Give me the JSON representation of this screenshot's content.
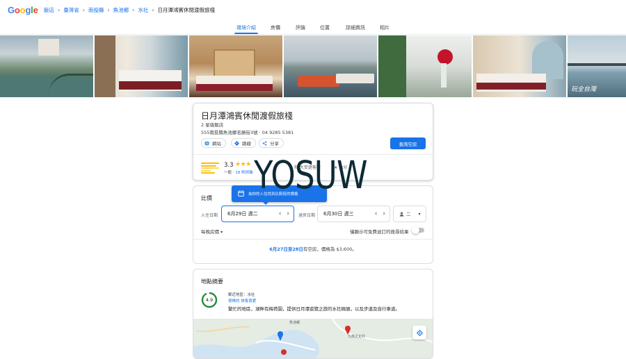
{
  "logo": {
    "letters": [
      {
        "ch": "G",
        "color": "#4285f4"
      },
      {
        "ch": "o",
        "color": "#ea4335"
      },
      {
        "ch": "o",
        "color": "#fbbc05"
      },
      {
        "ch": "g",
        "color": "#4285f4"
      },
      {
        "ch": "l",
        "color": "#34a853"
      },
      {
        "ch": "e",
        "color": "#ea4335"
      }
    ]
  },
  "breadcrumb": [
    "飯店",
    "臺灣省",
    "南投縣",
    "魚池鄉",
    "水社",
    "日月潭鴻賓休閒渡假旅棧"
  ],
  "tabs": [
    "環境介紹",
    "房價",
    "評論",
    "位置",
    "詳細資訊",
    "相片"
  ],
  "hotel": {
    "name": "日月潭鴻賓休閒渡假旅棧",
    "class": "2 星級飯店",
    "address": "555南投縣魚池鄉名勝街3號 · 04 9285 5381",
    "actions": {
      "website": "網站",
      "directions": "路線",
      "share": "分享"
    },
    "check_availability": "查詢空房",
    "rating": "3.3",
    "stars": "★★★",
    "rating_word": "一般",
    "reviews_link": "18 則評論",
    "faded_left": "和 大受遊客歡",
    "faded_right": "★ 點分"
  },
  "prices": {
    "title": "比價",
    "tooltip": "為你的入住找到比較低的價格",
    "checkin_label": "入住日期",
    "checkin_value": "6月29日 週二",
    "checkout_label": "退房日期",
    "checkout_value": "6月30日 週三",
    "guests": "二",
    "nightly": "每晚房價",
    "toggle_label": "僅顯示可免費退訂的搜尋結果",
    "availability_highlight": "6月27日至28日",
    "availability_rest": "有空房，價格為 $3,600。"
  },
  "location": {
    "title": "地點摘要",
    "score": "4.9",
    "near": "鄰近地區：水社",
    "tags": "很棒的 旅客喜愛",
    "desc": "繁忙的地區，湖畔有梅荷園，提供日月潭遊覽之旅的水社碼頭，以及步道及自行車道。",
    "map_labels": [
      "魚池鄉",
      "九族文化村"
    ]
  },
  "watermark": "YOSUW",
  "colors": {
    "accent": "#1a73e8",
    "star": "#fbbc04",
    "score_ring": "#1e8e3e"
  }
}
